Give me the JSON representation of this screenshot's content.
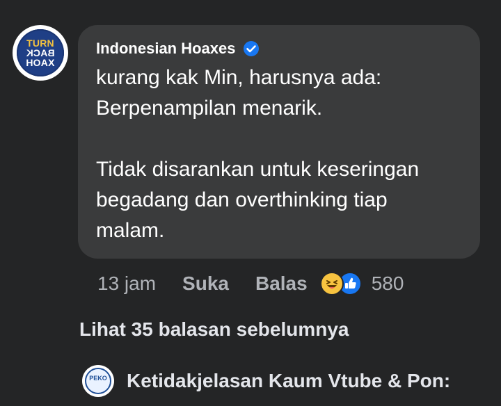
{
  "comment": {
    "avatar": {
      "icon": "turn-back-hoax-logo",
      "logo_lines": [
        "TURN",
        "BACK",
        "HOAX"
      ]
    },
    "author": "Indonesian Hoaxes",
    "verified_icon": "verified-badge-icon",
    "body": {
      "line1": "kurang kak Min, harusnya ada:",
      "line2": "Berpenampilan menarik.",
      "line3": "Tidak disarankan untuk keseringan",
      "line4": "begadang dan overthinking tiap",
      "line5": "malam."
    },
    "time": "13 jam",
    "like_label": "Suka",
    "reply_label": "Balas",
    "reactions": {
      "icons": [
        "haha-reaction-icon",
        "like-reaction-icon"
      ],
      "count": "580"
    }
  },
  "view_previous_replies": "Lihat 35 balasan sebelumnya",
  "reply_preview": {
    "avatar": {
      "icon": "peko-logo",
      "logo_text": "PEKO"
    },
    "author": "Ketidakjelasan Kaum Vtube & Pon:"
  },
  "colors": {
    "background": "#242526",
    "bubble": "#3a3b3c",
    "primary_text": "#ffffff",
    "secondary_text": "#b0b3b8",
    "accent_blue": "#1877f2",
    "haha_yellow": "#f7c340"
  }
}
